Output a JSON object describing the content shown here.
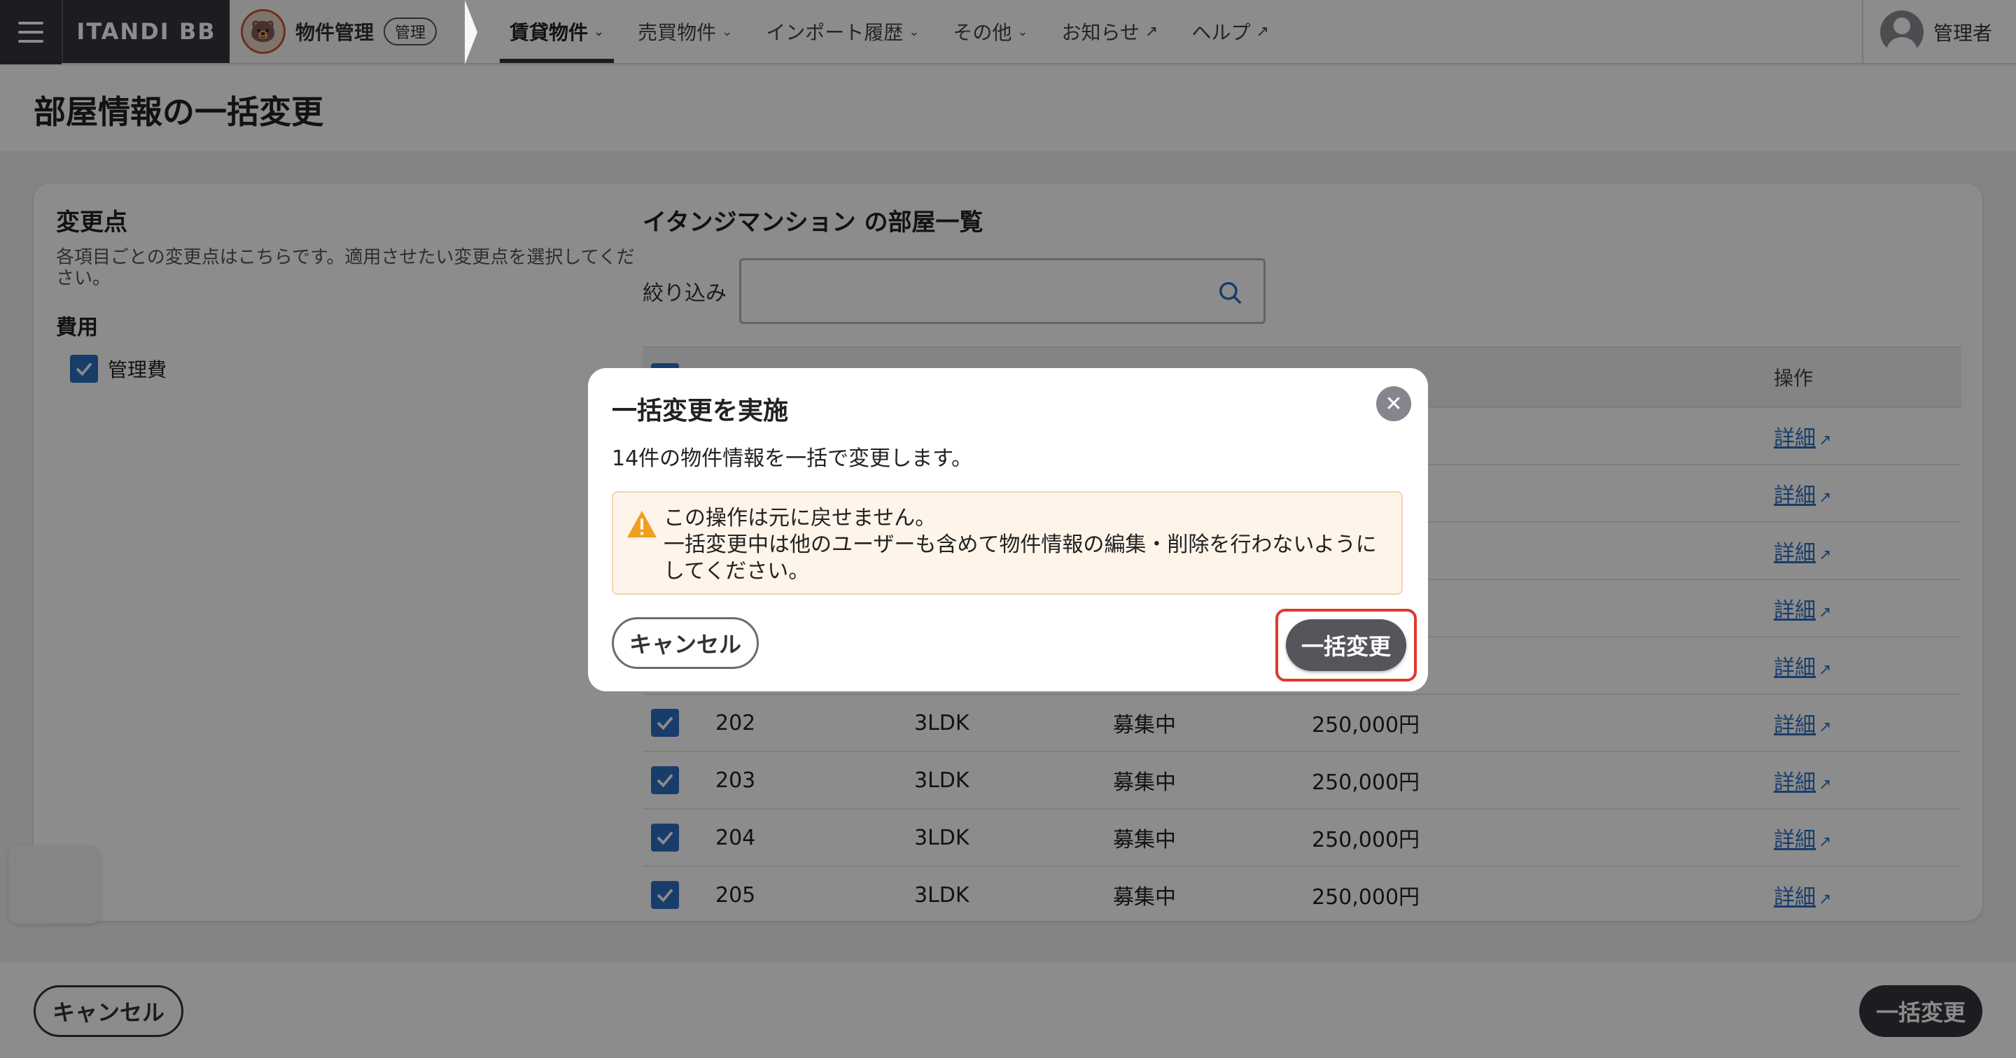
{
  "topbar": {
    "logo": "ITANDI BB",
    "product_name": "物件管理",
    "product_badge": "管理",
    "nav": [
      {
        "label": "賃貸物件"
      },
      {
        "label": "売買物件"
      },
      {
        "label": "インポート履歴"
      },
      {
        "label": "その他"
      },
      {
        "label": "お知らせ"
      },
      {
        "label": "ヘルプ"
      }
    ],
    "user_name": "管理者"
  },
  "page": {
    "title": "部屋情報の一括変更"
  },
  "changes": {
    "heading": "変更点",
    "description": "各項目ごとの変更点はこちらです。適用させたい変更点を選択してください。",
    "group_label": "費用",
    "item_label": "管理費"
  },
  "rooms": {
    "heading": "イタンジマンション の部屋一覧",
    "filter_label": "絞り込み",
    "filter_value": "",
    "column_action": "操作",
    "detail_label": "詳細",
    "rows": [
      {
        "room": "202",
        "layout": "3LDK",
        "status": "募集中",
        "rent": "250,000円"
      },
      {
        "room": "203",
        "layout": "3LDK",
        "status": "募集中",
        "rent": "250,000円"
      },
      {
        "room": "204",
        "layout": "3LDK",
        "status": "募集中",
        "rent": "250,000円"
      },
      {
        "room": "205",
        "layout": "3LDK",
        "status": "募集中",
        "rent": "250,000円"
      }
    ]
  },
  "footer": {
    "cancel_label": "キャンセル",
    "submit_label": "一括変更"
  },
  "modal": {
    "title": "一括変更を実施",
    "message": "14件の物件情報を一括で変更します。",
    "alert_line1": "この操作は元に戻せません。",
    "alert_line2": "一括変更中は他のユーザーも含めて物件情報の編集・削除を行わないようにしてください。",
    "cancel_label": "キャンセル",
    "confirm_label": "一括変更"
  },
  "colors": {
    "brand_dark": "#34343c",
    "link_blue": "#2f6fc1",
    "highlight_red": "#e0392b",
    "alert_bg": "#fff4ea",
    "warning_yellow": "#f0a020"
  }
}
